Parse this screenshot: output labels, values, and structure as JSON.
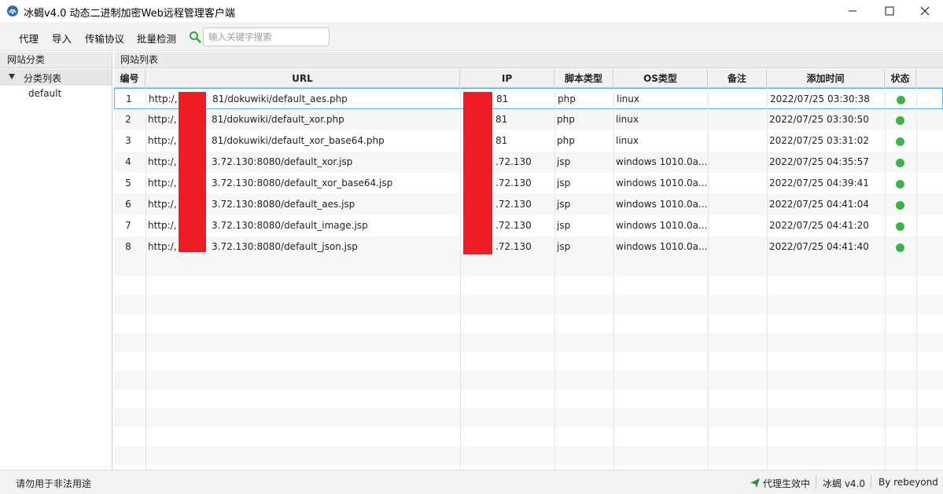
{
  "window": {
    "title": "冰蝎v4.0 动态二进制加密Web远程管理客户端",
    "icon": "scorpion-logo-icon"
  },
  "menu": {
    "items": [
      "代理",
      "导入",
      "传输协议",
      "批量检测"
    ],
    "search_placeholder": "输入关键字搜索",
    "search_value": ""
  },
  "left_panel": {
    "header": "网站分类",
    "tree_root": "分类列表",
    "tree_children": [
      "default"
    ]
  },
  "right_panel": {
    "header": "网站列表",
    "columns": [
      "编号",
      "URL",
      "IP",
      "脚本类型",
      "OS类型",
      "备注",
      "添加时间",
      "状态"
    ],
    "rows": [
      {
        "id": "1",
        "url_prefix": "http:/,",
        "url_suffix": "81/dokuwiki/default_aes.php",
        "ip": "81",
        "script": "php",
        "os": "linux",
        "note": "",
        "time": "2022/07/25 03:30:38",
        "status": "online"
      },
      {
        "id": "2",
        "url_prefix": "http:/,",
        "url_suffix": "81/dokuwiki/default_xor.php",
        "ip": "81",
        "script": "php",
        "os": "linux",
        "note": "",
        "time": "2022/07/25 03:30:50",
        "status": "online"
      },
      {
        "id": "3",
        "url_prefix": "http:/,",
        "url_suffix": "81/dokuwiki/default_xor_base64.php",
        "ip": "81",
        "script": "php",
        "os": "linux",
        "note": "",
        "time": "2022/07/25 03:31:02",
        "status": "online"
      },
      {
        "id": "4",
        "url_prefix": "http:/,",
        "url_suffix": "3.72.130:8080/default_xor.jsp",
        "ip": ".72.130",
        "script": "jsp",
        "os": "windows 1010.0a...",
        "note": "",
        "time": "2022/07/25 04:35:57",
        "status": "online"
      },
      {
        "id": "5",
        "url_prefix": "http:/,",
        "url_suffix": "3.72.130:8080/default_xor_base64.jsp",
        "ip": ".72.130",
        "script": "jsp",
        "os": "windows 1010.0a...",
        "note": "",
        "time": "2022/07/25 04:39:41",
        "status": "online"
      },
      {
        "id": "6",
        "url_prefix": "http:/,",
        "url_suffix": "3.72.130:8080/default_aes.jsp",
        "ip": ".72.130",
        "script": "jsp",
        "os": "windows 1010.0a...",
        "note": "",
        "time": "2022/07/25 04:41:04",
        "status": "online"
      },
      {
        "id": "7",
        "url_prefix": "http:/,",
        "url_suffix": "3.72.130:8080/default_image.jsp",
        "ip": ".72.130",
        "script": "jsp",
        "os": "windows 1010.0a...",
        "note": "",
        "time": "2022/07/25 04:41:20",
        "status": "online"
      },
      {
        "id": "8",
        "url_prefix": "http:/,",
        "url_suffix": "3.72.130:8080/default_json.jsp",
        "ip": ".72.130",
        "script": "jsp",
        "os": "windows 1010.0a...",
        "note": "",
        "time": "2022/07/25 04:41:40",
        "status": "online"
      }
    ]
  },
  "status_bar": {
    "left_text": "请勿用于非法用途",
    "proxy_text": "代理生效中",
    "app_version": "冰蝎 v4.0",
    "author": "By rebeyond"
  },
  "colors": {
    "online": "#3db34a",
    "redaction": "#ee1c25",
    "proxy_icon": "#2e8b3a"
  }
}
